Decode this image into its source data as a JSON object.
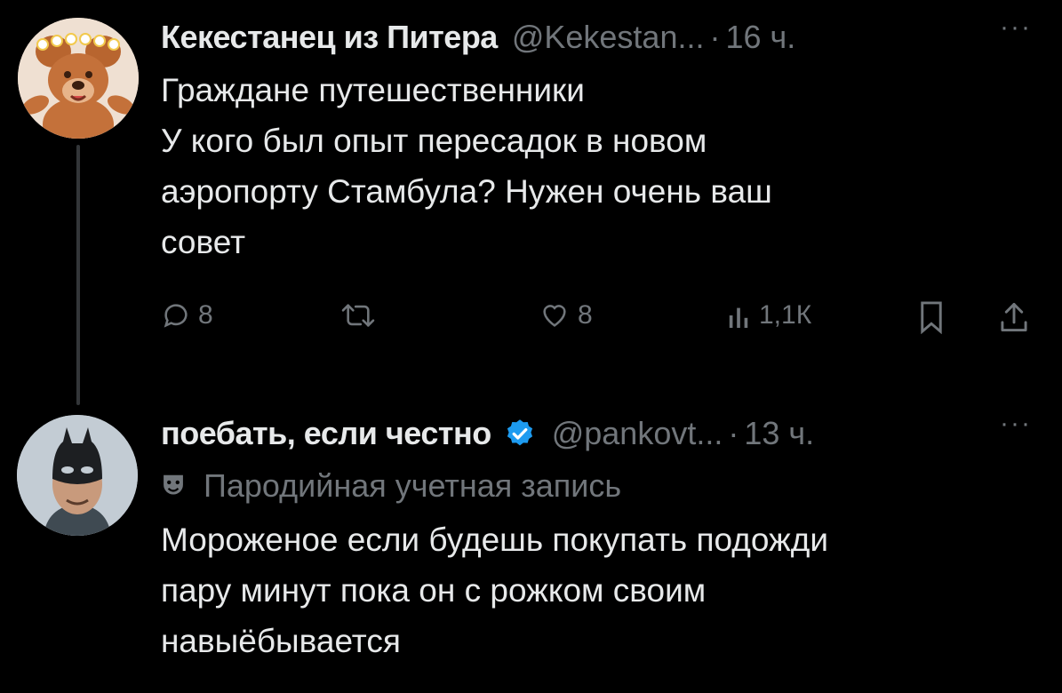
{
  "tweet": {
    "author_name": "Кекестанец из Питера",
    "handle": "@Kekestan...",
    "separator": "·",
    "time": "16 ч.",
    "more": "···",
    "lines": [
      "Граждане путешественники",
      "У кого был опыт пересадок в новом",
      "аэропорту Стамбула? Нужен очень ваш",
      "совет"
    ],
    "actions": {
      "replies": "8",
      "retweets": "",
      "likes": "8",
      "views": "1,1К"
    }
  },
  "reply": {
    "author_name": "поебать, если честно",
    "handle": "@pankovt...",
    "separator": "·",
    "time": "13 ч.",
    "more": "···",
    "parody_label": "Пародийная учетная запись",
    "lines": [
      "Мороженое если будешь покупать подожди",
      "пару минут пока он с рожком своим",
      "навыёбывается"
    ]
  },
  "icons": {
    "reply": "reply-icon",
    "retweet": "retweet-icon",
    "like": "heart-icon",
    "views": "views-icon",
    "bookmark": "bookmark-icon",
    "share": "share-icon",
    "verified": "verified-badge-icon",
    "parody": "theater-mask-icon"
  },
  "colors": {
    "background": "#000000",
    "text": "#e7e9ea",
    "muted": "#71767b",
    "verified": "#1d9bf0"
  }
}
